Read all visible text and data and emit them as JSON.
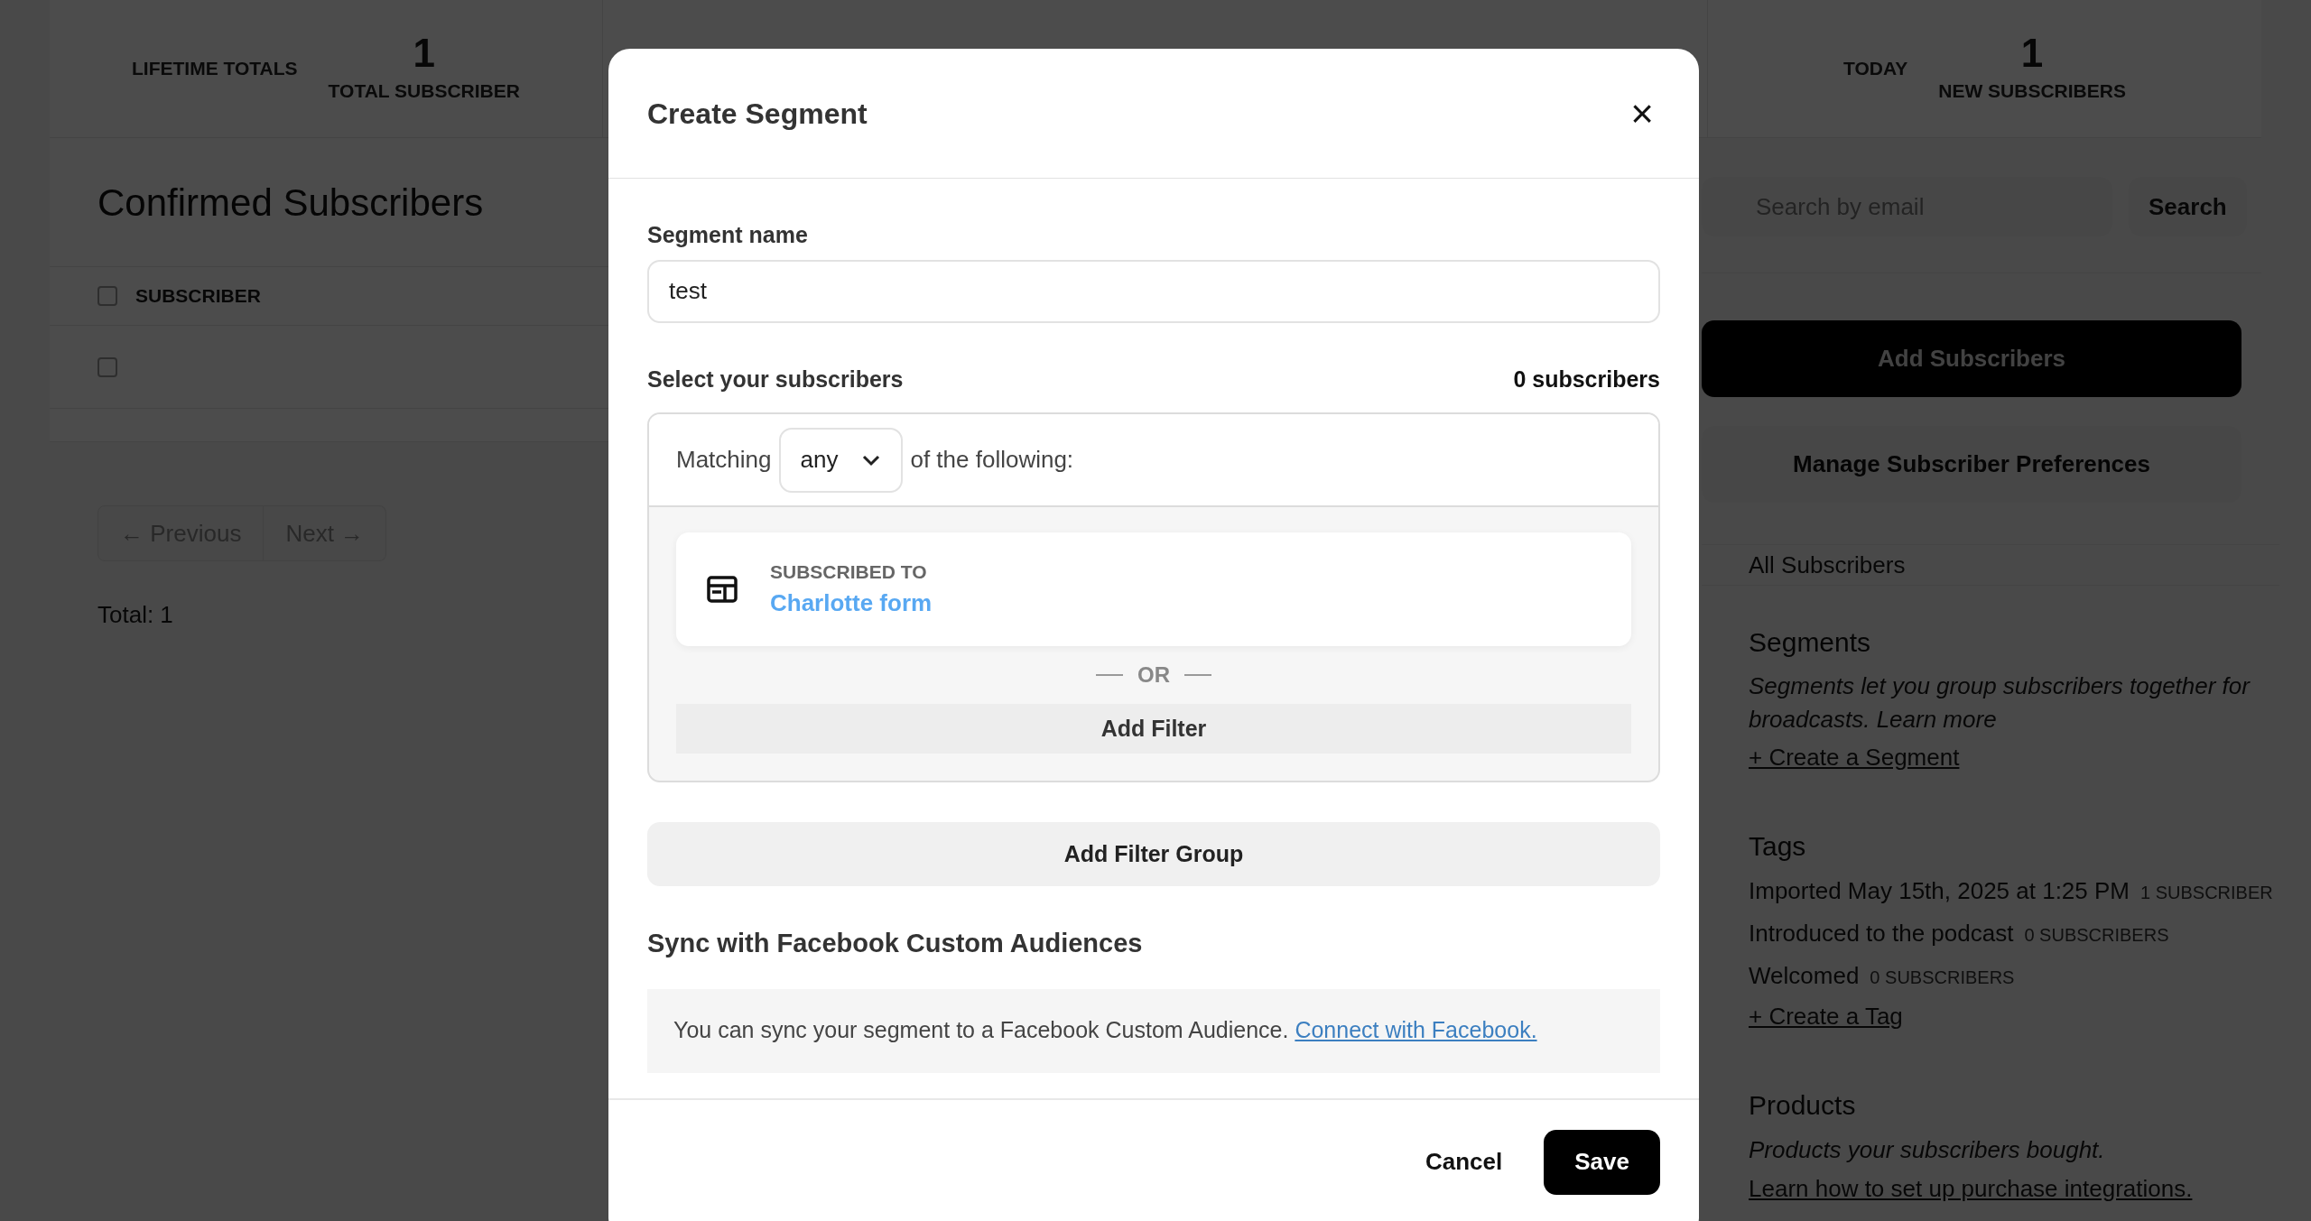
{
  "stats": {
    "lifetime": {
      "label": "LIFETIME TOTALS",
      "value": "1",
      "caption": "TOTAL SUBSCRIBER"
    },
    "today": {
      "label": "TODAY",
      "value": "1",
      "caption": "NEW SUBSCRIBERS"
    }
  },
  "subscribers_panel": {
    "title": "Confirmed Subscribers",
    "columns": [
      "SUBSCRIBER"
    ],
    "header_checked": false,
    "rows": [
      {
        "checked": false
      }
    ],
    "pagination": [
      {
        "label": "← Previous",
        "disabled": true
      },
      {
        "label": "Next →",
        "disabled": true
      }
    ],
    "total": "Total: 1"
  },
  "sidebar": {
    "search": {
      "placeholder": "Search by email",
      "button": "Search"
    },
    "buttons": [
      {
        "label": "Add Subscribers",
        "kind": "primary"
      },
      {
        "label": "Manage Subscriber Preferences",
        "kind": "secondary"
      }
    ],
    "nav": [
      "All Subscribers"
    ],
    "segments": {
      "title": "Segments",
      "description": "Segments let you group subscribers together for broadcasts.",
      "link": "Learn more",
      "action": "+ Create a Segment"
    },
    "tags": {
      "title": "Tags",
      "items": [
        {
          "name": "Imported May 15th, 2025 at 1:25 PM",
          "count": "1 SUBSCRIBER"
        },
        {
          "name": "Introduced to the podcast",
          "count": "0 SUBSCRIBERS"
        },
        {
          "name": "Welcomed",
          "count": "0 SUBSCRIBERS"
        }
      ],
      "action": "+ Create a Tag"
    },
    "products": {
      "title": "Products",
      "description": "Products your subscribers bought.",
      "action": "Learn how to set up purchase integrations."
    }
  },
  "modal": {
    "title": "Create Segment",
    "close": "×",
    "segment_name": {
      "label": "Segment name",
      "value": "test"
    },
    "select_label": "Select your subscribers",
    "count": "0 subscribers",
    "matching": {
      "prefix": "Matching",
      "value": "any",
      "suffix": "of the following:"
    },
    "filters": [
      {
        "label": "SUBSCRIBED TO",
        "value": "Charlotte form"
      }
    ],
    "or_label": "OR",
    "add_filter": "Add Filter",
    "add_filter_group": "Add Filter Group",
    "sync": {
      "heading": "Sync with Facebook Custom Audiences",
      "text": "You can sync your segment to a Facebook Custom Audience.",
      "link": "Connect with Facebook."
    },
    "buttons": {
      "cancel": "Cancel",
      "save": "Save"
    }
  }
}
